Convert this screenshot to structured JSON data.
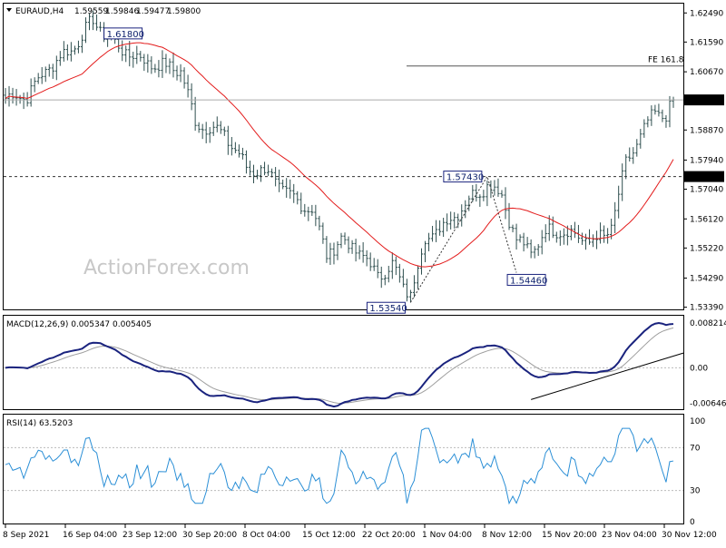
{
  "colors": {
    "price": "#2f4f4f",
    "ma": "#e31b1b",
    "macd": "#1a237e",
    "signal": "#9e9e9e",
    "rsi": "#2b8fd6",
    "label_box_fill": "#ffffff",
    "label_box_stroke": "#1a237e",
    "price_tag_fill": "#000000"
  },
  "chart_data": {
    "type": "candlestick",
    "header": {
      "symbol": "EURAUD,H4",
      "open": "1.59559",
      "high": "1.59846",
      "low": "1.59477",
      "close": "1.59800"
    },
    "watermark": "ActionForex.com",
    "x_labels": [
      "8 Sep 2021",
      "16 Sep 04:00",
      "23 Sep 12:00",
      "30 Sep 20:00",
      "8 Oct 04:00",
      "15 Oct 12:00",
      "22 Oct 20:00",
      "1 Nov 04:00",
      "8 Nov 12:00",
      "15 Nov 20:00",
      "23 Nov 04:00",
      "30 Nov 12:00"
    ],
    "price_panel": {
      "ylim": [
        1.5335,
        1.6275
      ],
      "yticks": [
        "1.62490",
        "1.61590",
        "1.60670",
        "1.59760",
        "1.58870",
        "1.57940",
        "1.57040",
        "1.56120",
        "1.55220",
        "1.54290",
        "1.53390"
      ],
      "tick_values": [
        1.6249,
        1.6159,
        1.6067,
        1.5976,
        1.5887,
        1.5794,
        1.5704,
        1.5612,
        1.5522,
        1.5429,
        1.5339
      ],
      "current_tag": "1.59800",
      "level_tag": "1.57430",
      "level_value": 1.5743,
      "fe_label": "FE 161.8",
      "fe_value": 1.6085,
      "annotations": [
        {
          "text": "1.61800",
          "bar": 28,
          "value": 1.618
        },
        {
          "text": "1.57430",
          "bar": 132,
          "value": 1.5743
        },
        {
          "text": "1.54460",
          "bar": 140,
          "value": 1.5446
        },
        {
          "text": "1.53540",
          "bar": 111,
          "value": 1.5354
        }
      ],
      "anchors": [
        [
          0,
          1.5985
        ],
        [
          6,
          1.5995
        ],
        [
          12,
          1.6085
        ],
        [
          18,
          1.6135
        ],
        [
          24,
          1.6225
        ],
        [
          30,
          1.615
        ],
        [
          36,
          1.611
        ],
        [
          42,
          1.6085
        ],
        [
          48,
          1.6075
        ],
        [
          52,
          1.591
        ],
        [
          60,
          1.5875
        ],
        [
          66,
          1.577
        ],
        [
          72,
          1.5755
        ],
        [
          78,
          1.568
        ],
        [
          84,
          1.564
        ],
        [
          88,
          1.5505
        ],
        [
          92,
          1.5545
        ],
        [
          96,
          1.552
        ],
        [
          102,
          1.544
        ],
        [
          106,
          1.5465
        ],
        [
          109,
          1.5405
        ],
        [
          111,
          1.538
        ],
        [
          115,
          1.555
        ],
        [
          120,
          1.559
        ],
        [
          126,
          1.566
        ],
        [
          132,
          1.572
        ],
        [
          136,
          1.5685
        ],
        [
          140,
          1.5545
        ],
        [
          144,
          1.551
        ],
        [
          148,
          1.557
        ],
        [
          152,
          1.558
        ],
        [
          156,
          1.556
        ],
        [
          160,
          1.5545
        ],
        [
          164,
          1.5555
        ],
        [
          166,
          1.559
        ],
        [
          170,
          1.578
        ],
        [
          174,
          1.587
        ],
        [
          178,
          1.594
        ],
        [
          181,
          1.5935
        ],
        [
          183,
          1.5975
        ]
      ]
    },
    "macd_panel": {
      "label": "MACD(12,26,9) 0.005347 0.005405",
      "ylim": [
        -0.0074,
        0.0092
      ],
      "yticks": [
        "0.008214",
        "0.00",
        "-0.006463"
      ],
      "tick_values": [
        0.008214,
        0.0,
        -0.006463
      ]
    },
    "rsi_panel": {
      "label": "RSI(14) 63.5203",
      "ylim": [
        0,
        100
      ],
      "yticks": [
        "100",
        "70",
        "30",
        "0"
      ],
      "tick_values": [
        100,
        70,
        30,
        0
      ],
      "levels": [
        70,
        30
      ]
    },
    "n_bars": 184
  }
}
